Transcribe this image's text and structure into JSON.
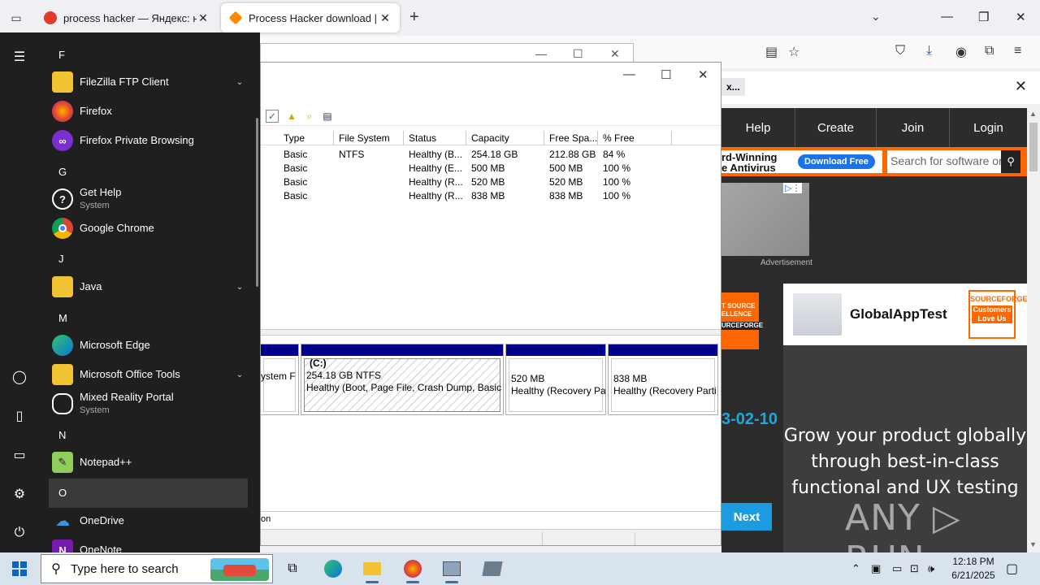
{
  "browser": {
    "tabs": [
      {
        "title": "process hacker — Яндекс: наш",
        "favicon_color": "#e23b2e",
        "active": false
      },
      {
        "title": "Process Hacker download | Sou",
        "favicon_color": "#ff8a00",
        "active": true
      }
    ],
    "notification_chip": "x..."
  },
  "sourceforge": {
    "nav": [
      "Help",
      "Create",
      "Join",
      "Login"
    ],
    "banner_promo_line1": "rd-Winning",
    "banner_promo_line2": "e Antivirus",
    "download_free": "Download Free",
    "search_placeholder": "Search for software or",
    "ad_label": "Advertisement",
    "award_text": "T SOURCE ELLENCE",
    "award_sub": "URCEFORGE",
    "date_fragment": "3-02-10",
    "next": "Next",
    "ad_brand": "GlobalAppTest",
    "ad_badge_top": "SOURCEFORGE",
    "ad_badge_mid": "Customers Love Us",
    "ad_message": "Grow your product globally through best-in-class functional and UX testing"
  },
  "disk_mgmt": {
    "columns": [
      "Type",
      "File System",
      "Status",
      "Capacity",
      "Free Spa...",
      "% Free"
    ],
    "rows": [
      [
        "Basic",
        "NTFS",
        "Healthy (B...",
        "254.18 GB",
        "212.88 GB",
        "84 %"
      ],
      [
        "Basic",
        "",
        "Healthy (E...",
        "500 MB",
        "500 MB",
        "100 %"
      ],
      [
        "Basic",
        "",
        "Healthy (R...",
        "520 MB",
        "520 MB",
        "100 %"
      ],
      [
        "Basic",
        "",
        "Healthy (R...",
        "838 MB",
        "838 MB",
        "100 %"
      ]
    ],
    "partitions": [
      {
        "line1": "",
        "line2": "ystem F"
      },
      {
        "line1": "(C:)",
        "line2": "254.18 GB NTFS",
        "line3": "Healthy (Boot, Page File, Crash Dump, Basic I"
      },
      {
        "line1": "",
        "line2": "520 MB",
        "line3": "Healthy (Recovery Pa"
      },
      {
        "line1": "",
        "line2": "838 MB",
        "line3": "Healthy (Recovery Parti"
      }
    ],
    "legend_fragment": "on"
  },
  "start_menu": {
    "letters": {
      "F": "F",
      "G": "G",
      "J": "J",
      "M": "M",
      "N": "N",
      "O": "O"
    },
    "apps": {
      "filezilla": "FileZilla FTP Client",
      "firefox": "Firefox",
      "firefox_private": "Firefox Private Browsing",
      "get_help": "Get Help",
      "get_help_sub": "System",
      "chrome": "Google Chrome",
      "java": "Java",
      "edge": "Microsoft Edge",
      "office_tools": "Microsoft Office Tools",
      "mixed_reality": "Mixed Reality Portal",
      "mixed_reality_sub": "System",
      "notepadpp": "Notepad++",
      "onedrive": "OneDrive",
      "onenote": "OneNote"
    }
  },
  "taskbar": {
    "search_placeholder": "Type here to search",
    "time": "12:18 PM",
    "date": "6/21/2025"
  },
  "watermark": "ANY ▷ RUN"
}
